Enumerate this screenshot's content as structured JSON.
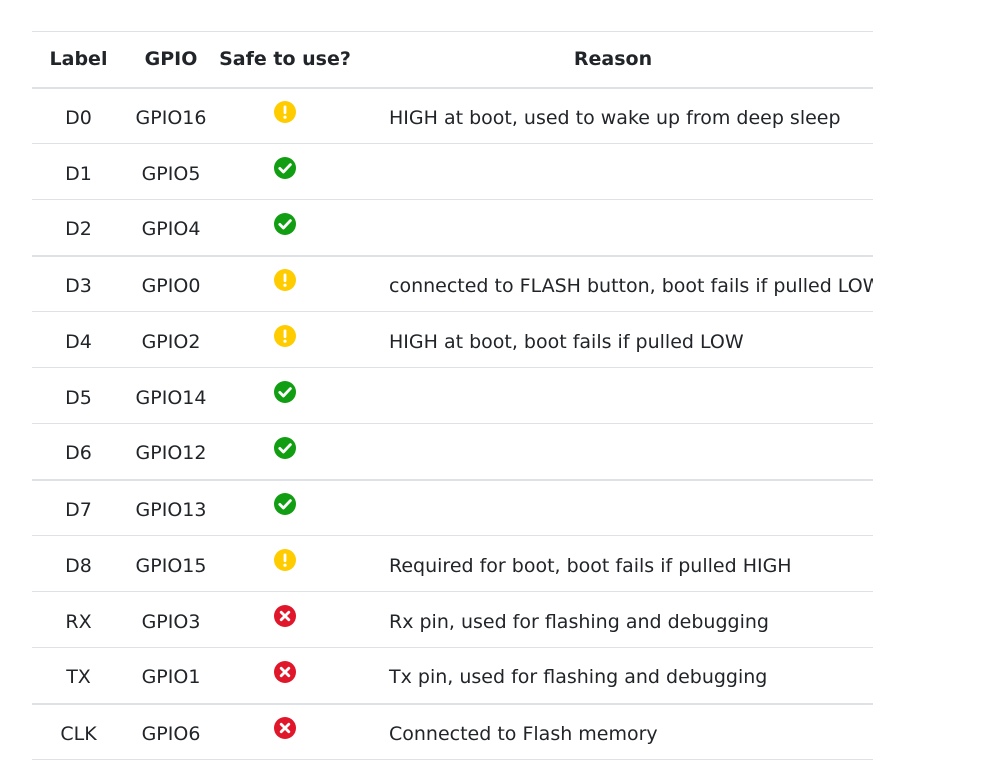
{
  "table": {
    "headers": {
      "label": "Label",
      "gpio": "GPIO",
      "safe": "Safe to use?",
      "reason": "Reason"
    },
    "colors": {
      "warning": "#ffcc00",
      "ok": "#129e12",
      "error": "#e0172b",
      "border": "#dee2e6",
      "text": "#212529"
    },
    "rows": [
      {
        "label": "D0",
        "gpio": "GPIO16",
        "status": "warning",
        "status_icon": "exclamation-circle-icon",
        "reason": "HIGH at boot, used to wake up from deep sleep"
      },
      {
        "label": "D1",
        "gpio": "GPIO5",
        "status": "ok",
        "status_icon": "check-circle-icon",
        "reason": ""
      },
      {
        "label": "D2",
        "gpio": "GPIO4",
        "status": "ok",
        "status_icon": "check-circle-icon",
        "reason": ""
      },
      {
        "label": "D3",
        "gpio": "GPIO0",
        "status": "warning",
        "status_icon": "exclamation-circle-icon",
        "reason": "connected to FLASH button, boot fails if pulled LOW"
      },
      {
        "label": "D4",
        "gpio": "GPIO2",
        "status": "warning",
        "status_icon": "exclamation-circle-icon",
        "reason": "HIGH at boot, boot fails if pulled LOW"
      },
      {
        "label": "D5",
        "gpio": "GPIO14",
        "status": "ok",
        "status_icon": "check-circle-icon",
        "reason": ""
      },
      {
        "label": "D6",
        "gpio": "GPIO12",
        "status": "ok",
        "status_icon": "check-circle-icon",
        "reason": ""
      },
      {
        "label": "D7",
        "gpio": "GPIO13",
        "status": "ok",
        "status_icon": "check-circle-icon",
        "reason": ""
      },
      {
        "label": "D8",
        "gpio": "GPIO15",
        "status": "warning",
        "status_icon": "exclamation-circle-icon",
        "reason": "Required for boot, boot fails if pulled HIGH"
      },
      {
        "label": "RX",
        "gpio": "GPIO3",
        "status": "error",
        "status_icon": "x-circle-icon",
        "reason": "Rx pin, used for flashing and debugging"
      },
      {
        "label": "TX",
        "gpio": "GPIO1",
        "status": "error",
        "status_icon": "x-circle-icon",
        "reason": "Tx pin, used for flashing and debugging"
      },
      {
        "label": "CLK",
        "gpio": "GPIO6",
        "status": "error",
        "status_icon": "x-circle-icon",
        "reason": "Connected to Flash memory"
      }
    ]
  }
}
